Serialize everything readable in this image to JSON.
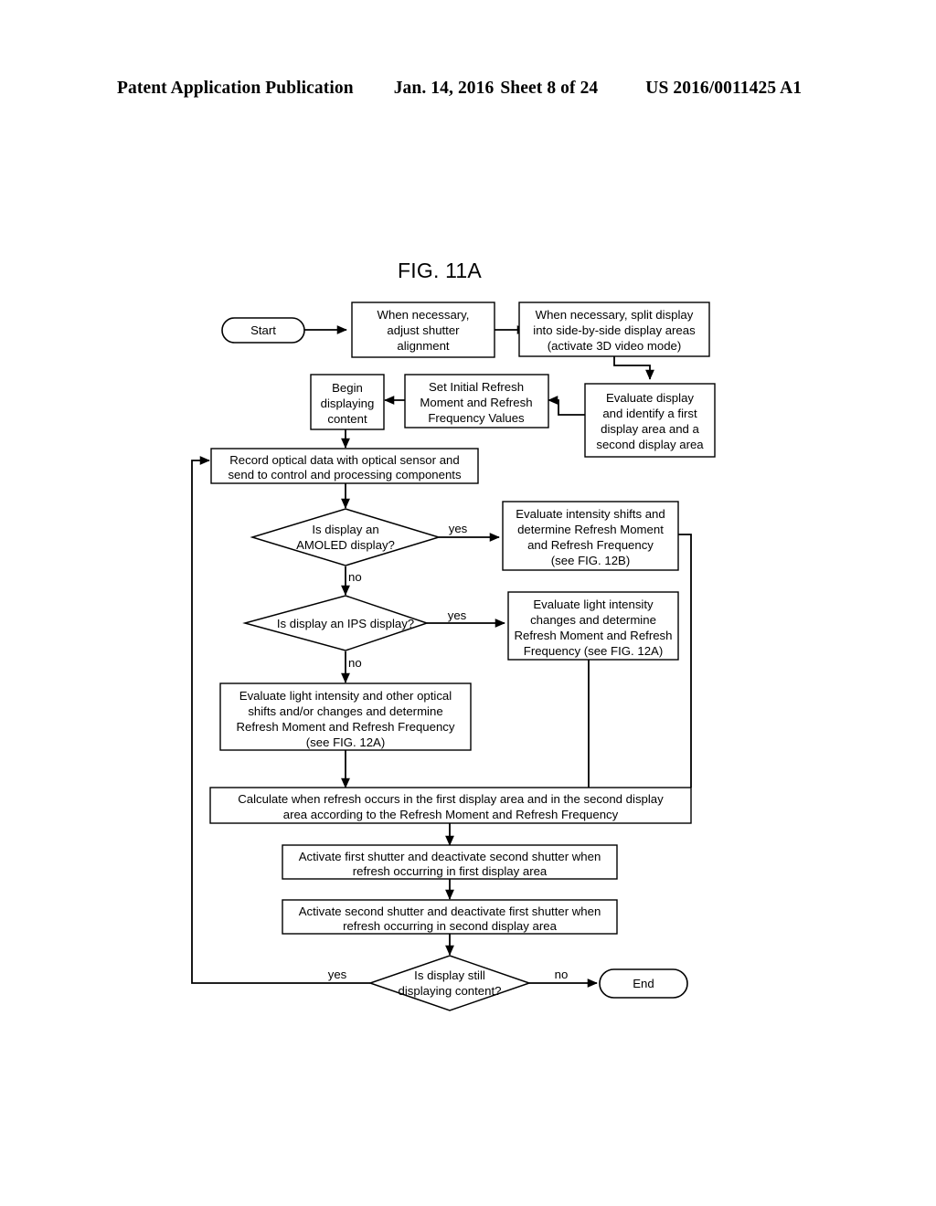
{
  "header": {
    "publication": "Patent Application Publication",
    "date": "Jan. 14, 2016",
    "sheet": "Sheet 8 of 24",
    "document_number": "US 2016/0011425 A1"
  },
  "figure": {
    "title": "FIG. 11A",
    "type": "flowchart"
  },
  "chart_data": {
    "type": "flowchart",
    "title": "FIG. 11A",
    "nodes": [
      {
        "id": "start",
        "shape": "terminator",
        "text": "Start"
      },
      {
        "id": "adjust",
        "shape": "process",
        "text": "When necessary, adjust shutter alignment"
      },
      {
        "id": "split",
        "shape": "process",
        "text": "When necessary, split display into side-by-side display areas (activate 3D video mode)"
      },
      {
        "id": "evaluate",
        "shape": "process",
        "text": "Evaluate display and identify a first display area and a second display area"
      },
      {
        "id": "setinitial",
        "shape": "process",
        "text": "Set Initial Refresh Moment and Refresh Frequency Values"
      },
      {
        "id": "begin",
        "shape": "process",
        "text": "Begin displaying content"
      },
      {
        "id": "record",
        "shape": "process",
        "text": "Record optical data with optical sensor and send to control and processing components"
      },
      {
        "id": "amoled",
        "shape": "decision",
        "text": "Is display an AMOLED display?"
      },
      {
        "id": "amoled_yes",
        "shape": "process",
        "text": "Evaluate intensity shifts and determine Refresh Moment and Refresh Frequency (see FIG. 12B)"
      },
      {
        "id": "ips",
        "shape": "decision",
        "text": "Is display an IPS display?"
      },
      {
        "id": "ips_yes",
        "shape": "process",
        "text": "Evaluate light intensity changes and determine Refresh Moment and Refresh Frequency (see FIG. 12A)"
      },
      {
        "id": "other",
        "shape": "process",
        "text": "Evaluate light intensity and other optical shifts and/or changes and determine Refresh Moment and Refresh Frequency (see FIG. 12A)"
      },
      {
        "id": "calculate",
        "shape": "process",
        "text": "Calculate when refresh occurs in the first display area and in the second display area according to the Refresh Moment and Refresh Frequency"
      },
      {
        "id": "shutter1",
        "shape": "process",
        "text": "Activate first shutter and deactivate second shutter when refresh occurring in first display area"
      },
      {
        "id": "shutter2",
        "shape": "process",
        "text": "Activate second shutter and deactivate first shutter when refresh occurring in second display area"
      },
      {
        "id": "stilldisp",
        "shape": "decision",
        "text": "Is display still displaying content?"
      },
      {
        "id": "end",
        "shape": "terminator",
        "text": "End"
      }
    ],
    "edges": [
      {
        "from": "start",
        "to": "adjust",
        "label": ""
      },
      {
        "from": "adjust",
        "to": "split",
        "label": ""
      },
      {
        "from": "split",
        "to": "evaluate",
        "label": ""
      },
      {
        "from": "evaluate",
        "to": "setinitial",
        "label": ""
      },
      {
        "from": "setinitial",
        "to": "begin",
        "label": ""
      },
      {
        "from": "begin",
        "to": "record",
        "label": ""
      },
      {
        "from": "record",
        "to": "amoled",
        "label": ""
      },
      {
        "from": "amoled",
        "to": "amoled_yes",
        "label": "yes"
      },
      {
        "from": "amoled",
        "to": "ips",
        "label": "no"
      },
      {
        "from": "ips",
        "to": "ips_yes",
        "label": "yes"
      },
      {
        "from": "ips",
        "to": "other",
        "label": "no"
      },
      {
        "from": "other",
        "to": "calculate",
        "label": ""
      },
      {
        "from": "amoled_yes",
        "to": "calculate",
        "label": ""
      },
      {
        "from": "ips_yes",
        "to": "calculate",
        "label": ""
      },
      {
        "from": "calculate",
        "to": "shutter1",
        "label": ""
      },
      {
        "from": "shutter1",
        "to": "shutter2",
        "label": ""
      },
      {
        "from": "shutter2",
        "to": "stilldisp",
        "label": ""
      },
      {
        "from": "stilldisp",
        "to": "record",
        "label": "yes"
      },
      {
        "from": "stilldisp",
        "to": "end",
        "label": "no"
      }
    ],
    "edge_labels": {
      "amoled_yes": "yes",
      "amoled_no": "no",
      "ips_yes": "yes",
      "ips_no": "no",
      "still_yes": "yes",
      "still_no": "no"
    },
    "node_lines": {
      "start": [
        "Start"
      ],
      "adjust": [
        "When necessary,",
        "adjust shutter",
        "alignment"
      ],
      "split": [
        "When necessary, split display",
        "into side-by-side display areas",
        "(activate 3D video mode)"
      ],
      "evaluate": [
        "Evaluate display",
        "and identify a first",
        "display area and a",
        "second display area"
      ],
      "setinitial": [
        "Set Initial Refresh",
        "Moment and Refresh",
        "Frequency Values"
      ],
      "begin": [
        "Begin",
        "displaying",
        "content"
      ],
      "record": [
        "Record optical data with optical sensor and",
        "send to control and processing components"
      ],
      "amoled": [
        "Is display an",
        "AMOLED display?"
      ],
      "amoled_yes": [
        "Evaluate intensity shifts and",
        "determine Refresh Moment",
        "and Refresh Frequency",
        "(see FIG. 12B)"
      ],
      "ips": [
        "Is display an IPS display?"
      ],
      "ips_yes": [
        "Evaluate light intensity",
        "changes and determine",
        "Refresh Moment and Refresh",
        "Frequency (see FIG. 12A)"
      ],
      "other": [
        "Evaluate light intensity and other optical",
        "shifts and/or changes and determine",
        "Refresh Moment and Refresh Frequency",
        "(see FIG. 12A)"
      ],
      "calculate": [
        "Calculate when refresh occurs in the first display area and in the second display",
        "area according to the Refresh Moment and Refresh Frequency"
      ],
      "shutter1": [
        "Activate first shutter and deactivate second shutter when",
        "refresh occurring in first display area"
      ],
      "shutter2": [
        "Activate second shutter and deactivate first shutter when",
        "refresh occurring in second display area"
      ],
      "stilldisp": [
        "Is display still",
        "displaying content?"
      ],
      "end": [
        "End"
      ]
    },
    "colors": {
      "background": "#ffffff",
      "stroke": "#000000",
      "text": "#000000",
      "fill": "#ffffff"
    }
  }
}
